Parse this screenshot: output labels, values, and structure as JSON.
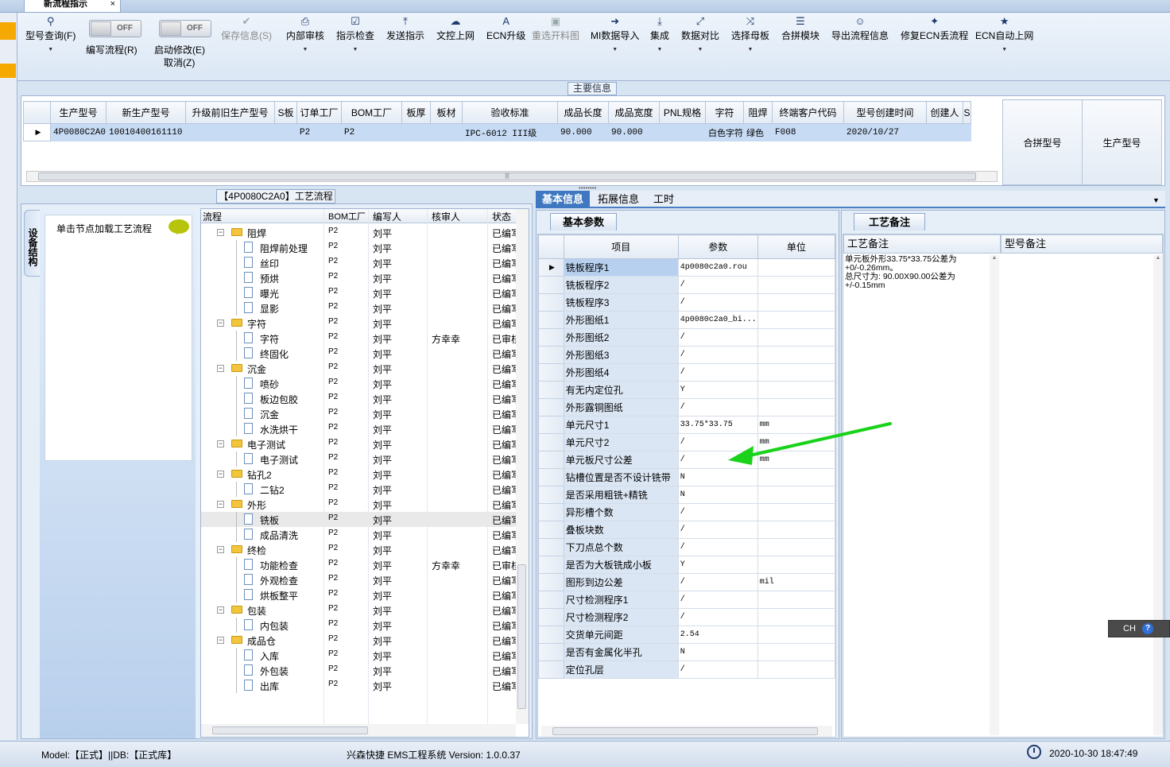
{
  "window": {
    "tab_title": "新流程指示",
    "tab_close": "×"
  },
  "toolbar": {
    "query": {
      "label": "型号查询(F)",
      "icon": "search-icon"
    },
    "write_flow": {
      "label": "编写流程(R)",
      "toggle": "OFF"
    },
    "start_modify": {
      "label": "启动修改(E)",
      "toggle": "OFF"
    },
    "cancel": {
      "label": "取消(Z)"
    },
    "save_info": {
      "label": "保存信息(S)",
      "icon": "check-icon"
    },
    "internal_review": {
      "label": "内部审核",
      "icon": "printer-icon"
    },
    "indicator_check": {
      "label": "指示检查",
      "icon": "checkbox-icon"
    },
    "send_indicator": {
      "label": "发送指示",
      "icon": "upload-icon"
    },
    "file_upload": {
      "label": "文控上网",
      "icon": "cloud-upload-icon"
    },
    "ecn_upgrade": {
      "label": "ECN升级",
      "icon": "font-icon"
    },
    "reselect_drawing": {
      "label": "重选开料图",
      "icon": "image-icon"
    },
    "mi_import": {
      "label": "MI数据导入",
      "icon": "import-icon"
    },
    "integrate": {
      "label": "集成",
      "icon": "download-icon"
    },
    "compare": {
      "label": "数据对比",
      "icon": "compress-icon"
    },
    "select_mother": {
      "label": "选择母板",
      "icon": "shuffle-icon"
    },
    "combine": {
      "label": "合拼模块",
      "icon": "list-icon"
    },
    "export": {
      "label": "导出流程信息",
      "icon": "smile-icon"
    },
    "repair": {
      "label": "修复ECN丢流程",
      "icon": "wrench-icon"
    },
    "ecn_auto": {
      "label": "ECN自动上网",
      "icon": "star-icon"
    }
  },
  "main_info": {
    "title": "主要信息",
    "columns": [
      "生产型号",
      "新生产型号",
      "升级前旧生产型号",
      "S板",
      "订单工厂",
      "BOM工厂",
      "板厚",
      "板材",
      "验收标准",
      "成品长度",
      "成品宽度",
      "PNL规格",
      "字符",
      "阻焊",
      "终端客户代码",
      "型号创建时间",
      "创建人",
      "S"
    ],
    "row": [
      "4P0080C2A0",
      "10010400161110",
      "",
      "",
      "P2",
      "P2",
      "",
      "",
      "IPC-6012 III级",
      "90.000",
      "90.000",
      "",
      "白色字符",
      "绿色",
      "F008",
      "2020/10/27",
      "",
      ""
    ],
    "side_columns": [
      "合拼型号",
      "生产型号"
    ]
  },
  "process": {
    "title": "【4P0080C2A0】工艺流程",
    "side_tab": "设备结构",
    "node_hint": "单击节点加载工艺流程",
    "columns": [
      "流程",
      "BOM工厂",
      "编写人",
      "核审人",
      "状态"
    ],
    "rows": [
      {
        "name": "阻焊",
        "level": 1,
        "bom": "P2",
        "author": "刘平",
        "reviewer": "",
        "status": "已编写"
      },
      {
        "name": "阻焊前处理",
        "level": 2,
        "bom": "P2",
        "author": "刘平",
        "reviewer": "",
        "status": "已编写"
      },
      {
        "name": "丝印",
        "level": 2,
        "bom": "P2",
        "author": "刘平",
        "reviewer": "",
        "status": "已编写"
      },
      {
        "name": "预烘",
        "level": 2,
        "bom": "P2",
        "author": "刘平",
        "reviewer": "",
        "status": "已编写"
      },
      {
        "name": "曝光",
        "level": 2,
        "bom": "P2",
        "author": "刘平",
        "reviewer": "",
        "status": "已编写"
      },
      {
        "name": "显影",
        "level": 2,
        "bom": "P2",
        "author": "刘平",
        "reviewer": "",
        "status": "已编写"
      },
      {
        "name": "字符",
        "level": 1,
        "bom": "P2",
        "author": "刘平",
        "reviewer": "",
        "status": "已编写"
      },
      {
        "name": "字符",
        "level": 2,
        "bom": "P2",
        "author": "刘平",
        "reviewer": "方幸幸",
        "status": "已审核"
      },
      {
        "name": "终固化",
        "level": 2,
        "bom": "P2",
        "author": "刘平",
        "reviewer": "",
        "status": "已编写"
      },
      {
        "name": "沉金",
        "level": 1,
        "bom": "P2",
        "author": "刘平",
        "reviewer": "",
        "status": "已编写"
      },
      {
        "name": "喷砂",
        "level": 2,
        "bom": "P2",
        "author": "刘平",
        "reviewer": "",
        "status": "已编写"
      },
      {
        "name": "板边包胶",
        "level": 2,
        "bom": "P2",
        "author": "刘平",
        "reviewer": "",
        "status": "已编写"
      },
      {
        "name": "沉金",
        "level": 2,
        "bom": "P2",
        "author": "刘平",
        "reviewer": "",
        "status": "已编写"
      },
      {
        "name": "水洗烘干",
        "level": 2,
        "bom": "P2",
        "author": "刘平",
        "reviewer": "",
        "status": "已编写"
      },
      {
        "name": "电子测试",
        "level": 1,
        "bom": "P2",
        "author": "刘平",
        "reviewer": "",
        "status": "已编写"
      },
      {
        "name": "电子测试",
        "level": 2,
        "bom": "P2",
        "author": "刘平",
        "reviewer": "",
        "status": "已编写"
      },
      {
        "name": "钻孔2",
        "level": 1,
        "bom": "P2",
        "author": "刘平",
        "reviewer": "",
        "status": "已编写"
      },
      {
        "name": "二钻2",
        "level": 2,
        "bom": "P2",
        "author": "刘平",
        "reviewer": "",
        "status": "已编写"
      },
      {
        "name": "外形",
        "level": 1,
        "bom": "P2",
        "author": "刘平",
        "reviewer": "",
        "status": "已编写"
      },
      {
        "name": "铣板",
        "level": 2,
        "bom": "P2",
        "author": "刘平",
        "reviewer": "",
        "status": "已编写",
        "selected": true
      },
      {
        "name": "成品清洗",
        "level": 2,
        "bom": "P2",
        "author": "刘平",
        "reviewer": "",
        "status": "已编写"
      },
      {
        "name": "终检",
        "level": 1,
        "bom": "P2",
        "author": "刘平",
        "reviewer": "",
        "status": "已编写"
      },
      {
        "name": "功能检查",
        "level": 2,
        "bom": "P2",
        "author": "刘平",
        "reviewer": "方幸幸",
        "status": "已审核"
      },
      {
        "name": "外观检查",
        "level": 2,
        "bom": "P2",
        "author": "刘平",
        "reviewer": "",
        "status": "已编写"
      },
      {
        "name": "烘板整平",
        "level": 2,
        "bom": "P2",
        "author": "刘平",
        "reviewer": "",
        "status": "已编写"
      },
      {
        "name": "包装",
        "level": 1,
        "bom": "P2",
        "author": "刘平",
        "reviewer": "",
        "status": "已编写"
      },
      {
        "name": "内包装",
        "level": 2,
        "bom": "P2",
        "author": "刘平",
        "reviewer": "",
        "status": "已编写"
      },
      {
        "name": "成品仓",
        "level": 1,
        "bom": "P2",
        "author": "刘平",
        "reviewer": "",
        "status": "已编写"
      },
      {
        "name": "入库",
        "level": 2,
        "bom": "P2",
        "author": "刘平",
        "reviewer": "",
        "status": "已编写"
      },
      {
        "name": "外包装",
        "level": 2,
        "bom": "P2",
        "author": "刘平",
        "reviewer": "",
        "status": "已编写"
      },
      {
        "name": "出库",
        "level": 2,
        "bom": "P2",
        "author": "刘平",
        "reviewer": "",
        "status": "已编写"
      }
    ]
  },
  "right_tabs": [
    "基本信息",
    "拓展信息",
    "工时"
  ],
  "basic_params": {
    "subtab": "基本参数",
    "columns": [
      "项目",
      "参数",
      "单位"
    ],
    "rows": [
      [
        "铣板程序1",
        "4p0080c2a0.rou",
        ""
      ],
      [
        "铣板程序2",
        "/",
        ""
      ],
      [
        "铣板程序3",
        "/",
        ""
      ],
      [
        "外形图纸1",
        "4p0080c2a0_bi...",
        ""
      ],
      [
        "外形图纸2",
        "/",
        ""
      ],
      [
        "外形图纸3",
        "/",
        ""
      ],
      [
        "外形图纸4",
        "/",
        ""
      ],
      [
        "有无内定位孔",
        "Y",
        ""
      ],
      [
        "外形露铜图纸",
        "/",
        ""
      ],
      [
        "单元尺寸1",
        "33.75*33.75",
        "mm"
      ],
      [
        "单元尺寸2",
        "/",
        "mm"
      ],
      [
        "单元板尺寸公差",
        "/",
        "mm"
      ],
      [
        "钻槽位置是否不设计铣带",
        "N",
        ""
      ],
      [
        "是否采用粗铣+精铣",
        "N",
        ""
      ],
      [
        "异形槽个数",
        "/",
        ""
      ],
      [
        "叠板块数",
        "/",
        ""
      ],
      [
        "下刀点总个数",
        "/",
        ""
      ],
      [
        "是否为大板铣成小板",
        "Y",
        ""
      ],
      [
        "图形到边公差",
        "/",
        "mil"
      ],
      [
        "尺寸检测程序1",
        "/",
        ""
      ],
      [
        "尺寸检测程序2",
        "/",
        ""
      ],
      [
        "交货单元间距",
        "2.54",
        ""
      ],
      [
        "是否有金属化半孔",
        "N",
        ""
      ],
      [
        "定位孔层",
        "/",
        ""
      ]
    ]
  },
  "process_notes": {
    "subtab": "工艺备注",
    "col1": "工艺备注",
    "col2": "型号备注",
    "text": "单元板外形33.75*33.75公差为+0/-0.26mm。\n总尺寸为: 90.00X90.00公差为+/-0.15mm"
  },
  "ime": {
    "lang": "CH",
    "help": "?"
  },
  "status": {
    "model": "Model:【正式】||DB:【正式库】",
    "app": "兴森快捷 EMS工程系统 Version: 1.0.0.37",
    "datetime": "2020-10-30 18:47:49"
  },
  "colors": {
    "accent": "#3f78c0",
    "selection": "#c7dbf4",
    "annotation_arrow": "#19d219"
  }
}
